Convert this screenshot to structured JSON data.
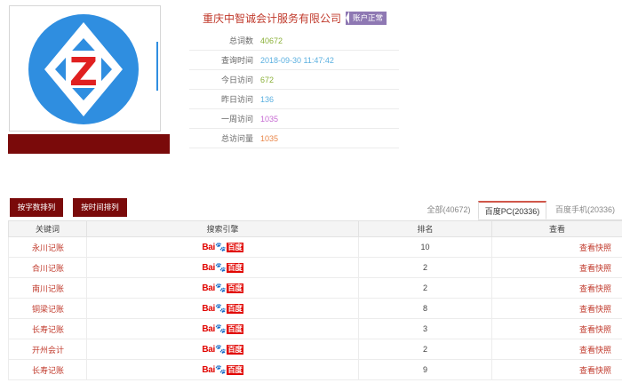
{
  "company": {
    "name": "重庆中智诚会计服务有限公司",
    "status_badge": "账户正常",
    "logo_letter": "Z"
  },
  "stats": [
    {
      "label": "总词数",
      "value": "40672",
      "color": "#8bb13a"
    },
    {
      "label": "查询时间",
      "value": "2018-09-30 11:47:42",
      "color": "#5bb0e0"
    },
    {
      "label": "今日访问",
      "value": "672",
      "color": "#8bb13a"
    },
    {
      "label": "昨日访问",
      "value": "136",
      "color": "#5bb0e0"
    },
    {
      "label": "一周访问",
      "value": "1035",
      "color": "#c76cd3"
    },
    {
      "label": "总访问量",
      "value": "1035",
      "color": "#e9874a"
    }
  ],
  "sort_buttons": {
    "by_count": "按字数排列",
    "by_time": "按时间排列"
  },
  "tabs": [
    {
      "label": "全部(40672)",
      "active": false
    },
    {
      "label": "百度PC(20336)",
      "active": true
    },
    {
      "label": "百度手机(20336)",
      "active": false
    }
  ],
  "table": {
    "headers": [
      "关键词",
      "搜索引擎",
      "排名",
      "查看"
    ],
    "engine_logo": {
      "text_bai": "Bai",
      "text_du": "百度"
    },
    "rows": [
      {
        "keyword": "永川记账",
        "rank": "10",
        "view": "查看快照"
      },
      {
        "keyword": "合川记账",
        "rank": "2",
        "view": "查看快照"
      },
      {
        "keyword": "南川记账",
        "rank": "2",
        "view": "查看快照"
      },
      {
        "keyword": "铜梁记账",
        "rank": "8",
        "view": "查看快照"
      },
      {
        "keyword": "长寿记账",
        "rank": "3",
        "view": "查看快照"
      },
      {
        "keyword": "开州会计",
        "rank": "2",
        "view": "查看快照"
      },
      {
        "keyword": "长寿记账",
        "rank": "9",
        "view": "查看快照"
      }
    ]
  },
  "colors": {
    "accent": "#7a0a0a",
    "link": "#c0392b",
    "logo_blue": "#2f8ee0",
    "logo_red": "#e02020"
  }
}
